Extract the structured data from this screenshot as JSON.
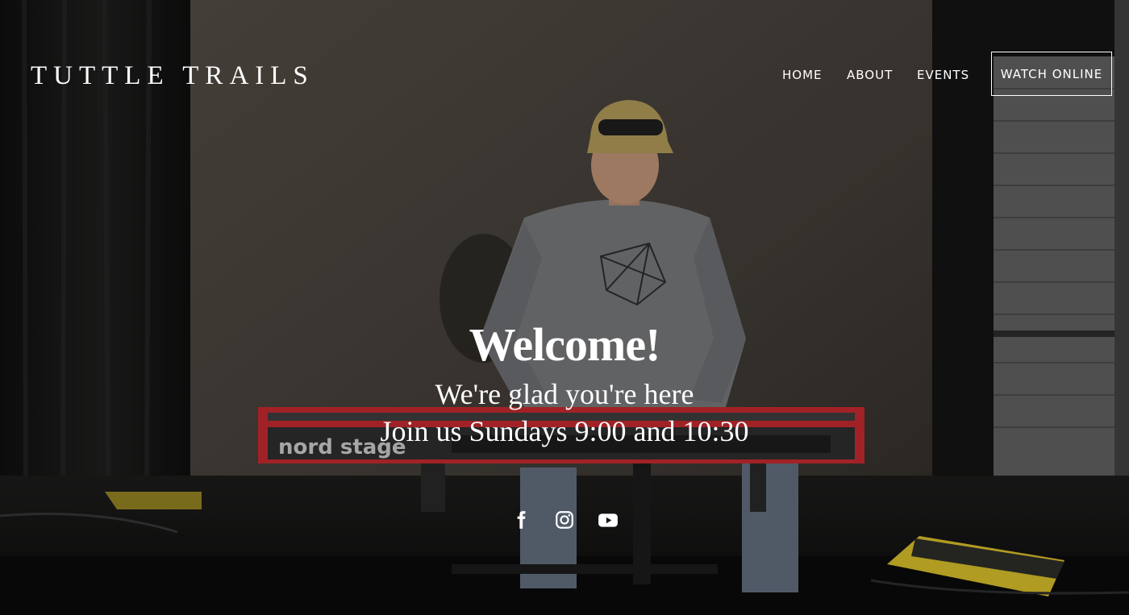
{
  "site": {
    "title": "TUTTLE TRAILS"
  },
  "nav": {
    "home": "HOME",
    "about": "ABOUT",
    "events": "EVENTS",
    "watch_online": "WATCH ONLINE"
  },
  "hero": {
    "heading": "Welcome!",
    "line1": "We're glad you're here",
    "line2": "Join us Sundays 9:00 and 10:30",
    "keyboard_brand": "nord stage"
  },
  "social": [
    "facebook-icon",
    "instagram-icon",
    "youtube-icon"
  ],
  "colors": {
    "text": "#ffffff",
    "keyboard_red": "#b8272c",
    "backdrop": "#4a443c"
  }
}
